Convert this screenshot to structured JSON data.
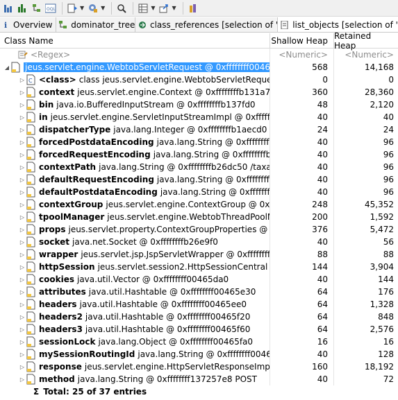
{
  "toolbar": {
    "icons": [
      "histogram-icon",
      "bar-chart-icon",
      "dominator-tree-icon",
      "oql-icon",
      "run-report-icon",
      "query-browser-icon",
      "search-icon",
      "grid-icon",
      "export-icon",
      "pin-icon"
    ]
  },
  "tabs": [
    {
      "label": "Overview",
      "icon": "info-icon"
    },
    {
      "label": "dominator_tree",
      "icon": "tree-icon"
    },
    {
      "label": "class_references  [selection of 'W...",
      "icon": "class-refs-icon"
    },
    {
      "label": "list_objects  [selection of 'Webto",
      "icon": "list-icon"
    }
  ],
  "columns": {
    "name": "Class Name",
    "shallow": "Shallow Heap",
    "retained": "Retained Heap"
  },
  "filter": {
    "name": "<Regex>",
    "shallow": "<Numeric>",
    "retained": "<Numeric>"
  },
  "root": {
    "text": "jeus.servlet.engine.WebtobServletRequest @ 0xffffffff00465b68",
    "shallow": "568",
    "retained": "14,168"
  },
  "rows": [
    {
      "field": "<class>",
      "rest": "class jeus.servlet.engine.WebtobServletRequest @ 0",
      "shallow": "0",
      "retained": "0",
      "kind": "class"
    },
    {
      "field": "context",
      "rest": "jeus.servlet.engine.Context @ 0xffffffffb131a70",
      "shallow": "360",
      "retained": "28,360"
    },
    {
      "field": "bin",
      "rest": "java.io.BufferedInputStream @ 0xffffffffb137fd0",
      "shallow": "48",
      "retained": "2,120"
    },
    {
      "field": "in",
      "rest": "jeus.servlet.engine.ServletInputStreamImpl @ 0xffffffffb1",
      "shallow": "40",
      "retained": "40"
    },
    {
      "field": "dispatcherType",
      "rest": "java.lang.Integer @ 0xffffffffb1aecd0  8",
      "shallow": "24",
      "retained": "24"
    },
    {
      "field": "forcedPostdataEncoding",
      "rest": "java.lang.String @ 0xffffffffb222",
      "shallow": "40",
      "retained": "96"
    },
    {
      "field": "forcedRequestEncoding",
      "rest": "java.lang.String @ 0xffffffffb222c",
      "shallow": "40",
      "retained": "96"
    },
    {
      "field": "contextPath",
      "rest": "java.lang.String @ 0xffffffffb26dc50  /taxapps",
      "shallow": "40",
      "retained": "96"
    },
    {
      "field": "defaultRequestEncoding",
      "rest": "java.lang.String @ 0xffffffffb26e",
      "shallow": "40",
      "retained": "96"
    },
    {
      "field": "defaultPostdataEncoding",
      "rest": "java.lang.String @ 0xffffffffb26e",
      "shallow": "40",
      "retained": "96"
    },
    {
      "field": "contextGroup",
      "rest": "jeus.servlet.engine.ContextGroup @ 0xffffffffe",
      "shallow": "248",
      "retained": "45,352"
    },
    {
      "field": "tpoolManager",
      "rest": "jeus.servlet.engine.WebtobThreadPoolManag",
      "shallow": "200",
      "retained": "1,592"
    },
    {
      "field": "props",
      "rest": "jeus.servlet.property.ContextGroupProperties @ 0xffff",
      "shallow": "376",
      "retained": "5,472"
    },
    {
      "field": "socket",
      "rest": "java.net.Socket @ 0xffffffffb26e9f0",
      "shallow": "40",
      "retained": "56"
    },
    {
      "field": "wrapper",
      "rest": "jeus.servlet.jsp.JspServletWrapper @ 0xffffffffe4ce",
      "shallow": "88",
      "retained": "88"
    },
    {
      "field": "httpSession",
      "rest": "jeus.servlet.session2.HttpSessionCentral @ 0xff",
      "shallow": "144",
      "retained": "3,904"
    },
    {
      "field": "cookies",
      "rest": "java.util.Vector @ 0xffffffff00465da0",
      "shallow": "40",
      "retained": "144"
    },
    {
      "field": "attributes",
      "rest": "java.util.Hashtable @ 0xffffffff00465e30",
      "shallow": "64",
      "retained": "176"
    },
    {
      "field": "headers",
      "rest": "java.util.Hashtable @ 0xffffffff00465ee0",
      "shallow": "64",
      "retained": "1,328"
    },
    {
      "field": "headers2",
      "rest": "java.util.Hashtable @ 0xffffffff00465f20",
      "shallow": "64",
      "retained": "848"
    },
    {
      "field": "headers3",
      "rest": "java.util.Hashtable @ 0xffffffff00465f60",
      "shallow": "64",
      "retained": "2,576"
    },
    {
      "field": "sessionLock",
      "rest": "java.lang.Object @ 0xffffffff00465fa0",
      "shallow": "16",
      "retained": "16"
    },
    {
      "field": "mySessionRoutingId",
      "rest": "java.lang.String @ 0xffffffff00466010",
      "shallow": "40",
      "retained": "128"
    },
    {
      "field": "response",
      "rest": "jeus.servlet.engine.HttpServletResponseImpl @ 0x",
      "shallow": "160",
      "retained": "18,192"
    },
    {
      "field": "method",
      "rest": "java.lang.String @ 0xffffffff137257e8  POST",
      "shallow": "40",
      "retained": "72"
    }
  ],
  "total": {
    "symbol": "Σ",
    "text": "Total: 25 of 37 entries"
  },
  "colors": {
    "selection": "#3399ff",
    "object_icon": "#f3c63f"
  }
}
